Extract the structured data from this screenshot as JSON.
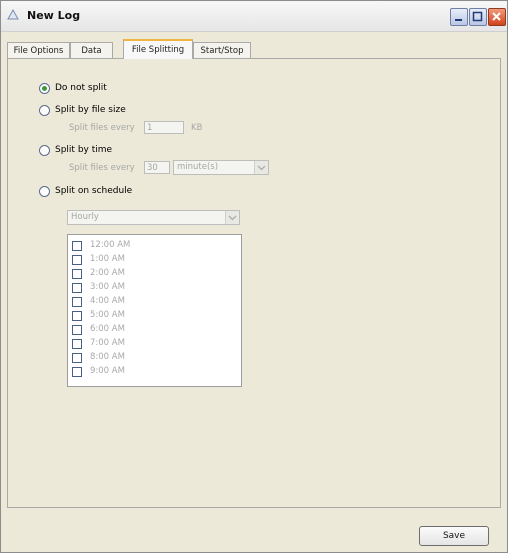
{
  "window": {
    "title": "New Log",
    "icons": {
      "app": "log-app-icon",
      "minimize": "minimize-icon",
      "maximize": "maximize-icon",
      "close": "close-icon"
    },
    "accent_color": "#f2b441",
    "close_color": "#d1421b"
  },
  "tabs": [
    {
      "label": "File Options"
    },
    {
      "label": "Data"
    },
    {
      "label": "File Splitting",
      "active": true
    },
    {
      "label": "Start/Stop"
    }
  ],
  "split": {
    "options": [
      {
        "label": "Do not split",
        "selected": true
      },
      {
        "label": "Split by file size",
        "selected": false
      },
      {
        "label": "Split by time",
        "selected": false
      },
      {
        "label": "Split on schedule",
        "selected": false
      }
    ],
    "size": {
      "prefix": "Split files every",
      "value": "1",
      "unit": "KB"
    },
    "time": {
      "prefix": "Split files every",
      "value": "30",
      "unit": "minute(s)"
    },
    "schedule": {
      "frequency": "Hourly",
      "times": [
        "12:00 AM",
        "1:00 AM",
        "2:00 AM",
        "3:00 AM",
        "4:00 AM",
        "5:00 AM",
        "6:00 AM",
        "7:00 AM",
        "8:00 AM",
        "9:00 AM"
      ]
    }
  },
  "footer": {
    "save_label": "Save"
  }
}
